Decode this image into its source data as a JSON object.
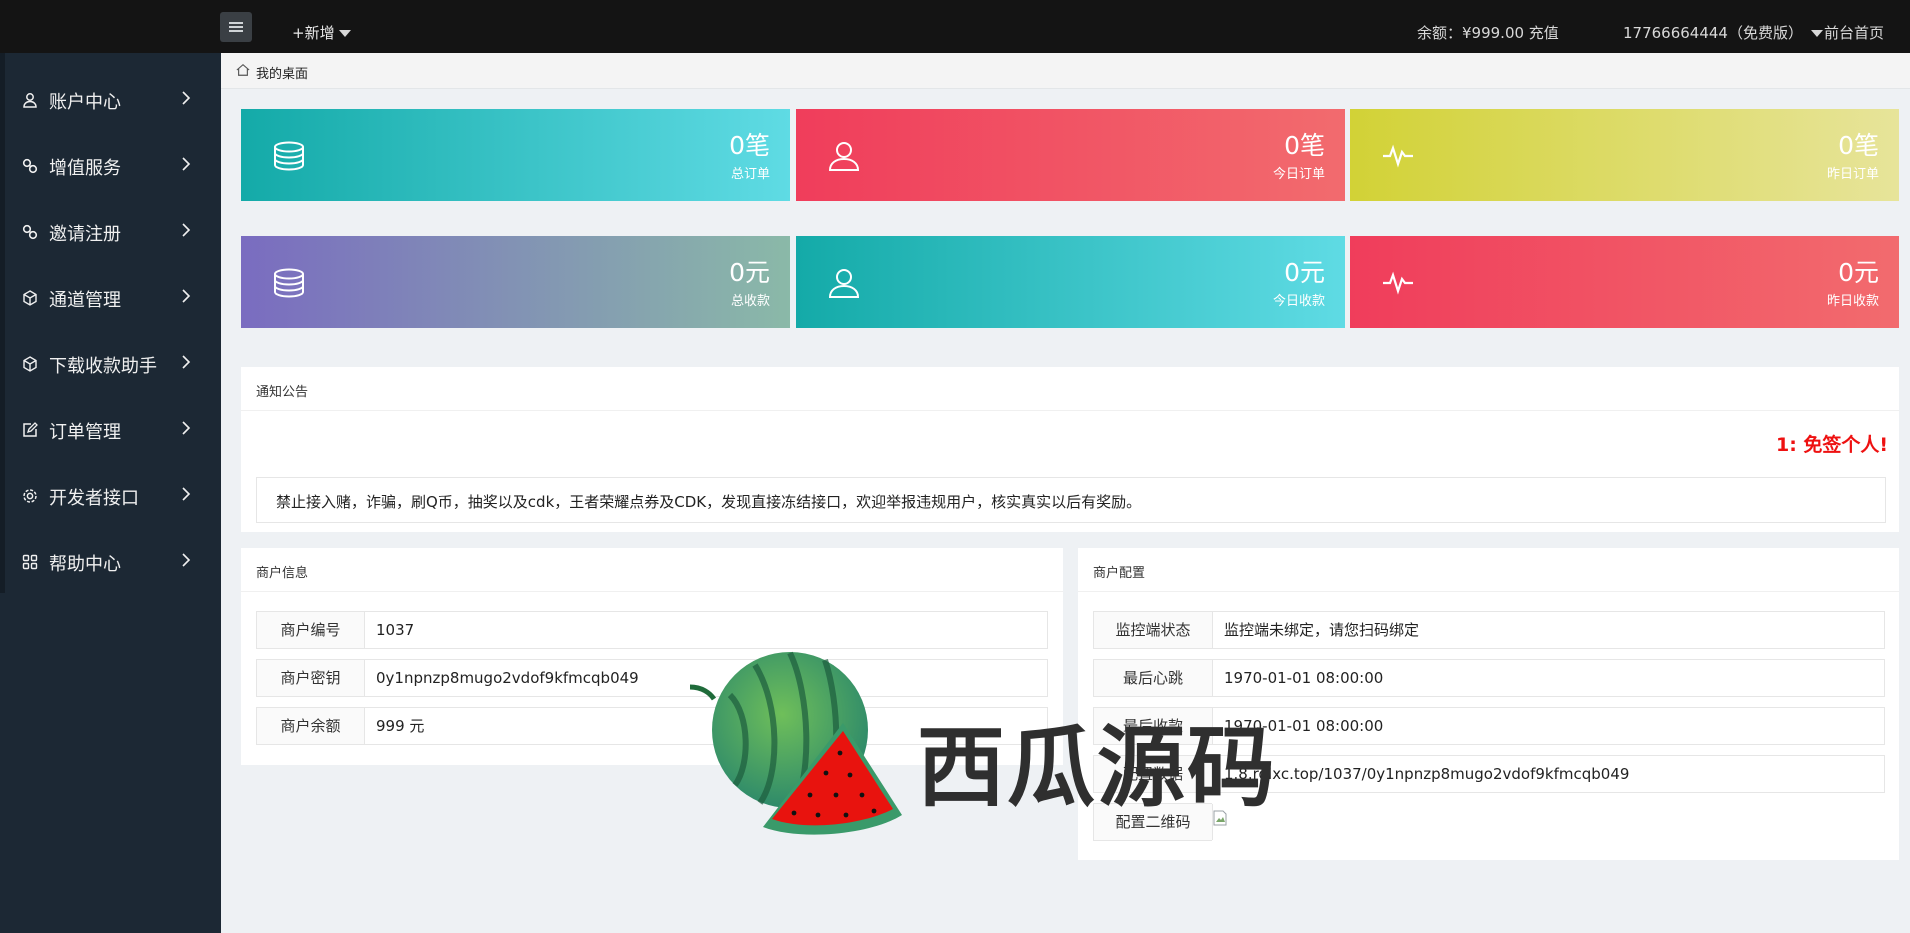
{
  "topbar": {
    "new_label": "+新增",
    "balance_label": "余额：¥999.00 充值",
    "user_label": "17766664444（免费版）",
    "home_label": "前台首页"
  },
  "sidebar": {
    "items": [
      {
        "label": "账户中心",
        "icon": "user-icon"
      },
      {
        "label": "增值服务",
        "icon": "link-icon"
      },
      {
        "label": "邀请注册",
        "icon": "link-icon"
      },
      {
        "label": "通道管理",
        "icon": "cube-icon"
      },
      {
        "label": "下载收款助手",
        "icon": "cube-icon"
      },
      {
        "label": "订单管理",
        "icon": "edit-icon"
      },
      {
        "label": "开发者接口",
        "icon": "gear-icon"
      },
      {
        "label": "帮助中心",
        "icon": "grid-icon"
      }
    ]
  },
  "breadcrumb": {
    "label": "我的桌面"
  },
  "stats": [
    {
      "value": "0笔",
      "label": "总订单",
      "icon": "database-icon",
      "from": "#14aaa8",
      "to": "#5fdbe4"
    },
    {
      "value": "0笔",
      "label": "今日订单",
      "icon": "user-icon",
      "from": "#f03d5b",
      "to": "#f26b6e"
    },
    {
      "value": "0笔",
      "label": "昨日订单",
      "icon": "pulse-icon",
      "from": "#d2d236",
      "to": "#e7e49a"
    },
    {
      "value": "0元",
      "label": "总收款",
      "icon": "database-icon",
      "from": "#7a6cc0",
      "to": "#8ab9a8"
    },
    {
      "value": "0元",
      "label": "今日收款",
      "icon": "user-icon",
      "from": "#14aaa8",
      "to": "#5fdbe4"
    },
    {
      "value": "0元",
      "label": "昨日收款",
      "icon": "pulse-icon",
      "from": "#f03d5b",
      "to": "#f26b6e"
    }
  ],
  "notice": {
    "title": "通知公告",
    "marquee": "1: 免签个人!",
    "text": "禁止接入赌，诈骗，刷Q币，抽奖以及cdk，王者荣耀点券及CDK，发现直接冻结接口，欢迎举报违规用户，核实真实以后有奖励。"
  },
  "merchant_info": {
    "title": "商户信息",
    "rows": [
      {
        "key": "商户编号",
        "value": "1037"
      },
      {
        "key": "商户密钥",
        "value": "0y1npnzp8mugo2vdof9kfmcqb049"
      },
      {
        "key": "商户余额",
        "value": "999 元"
      }
    ]
  },
  "merchant_config": {
    "title": "商户配置",
    "rows": [
      {
        "key": "监控端状态",
        "value": "监控端未绑定，请您扫码绑定"
      },
      {
        "key": "最后心跳",
        "value": "1970-01-01 08:00:00"
      },
      {
        "key": "最后收款",
        "value": "1970-01-01 08:00:00"
      },
      {
        "key": "配置数据",
        "value": "1.8.rglxc.top/1037/0y1npnzp8mugo2vdof9kfmcqb049"
      },
      {
        "key": "配置二维码",
        "value": ""
      }
    ]
  },
  "watermark": {
    "text": "西瓜源码"
  }
}
